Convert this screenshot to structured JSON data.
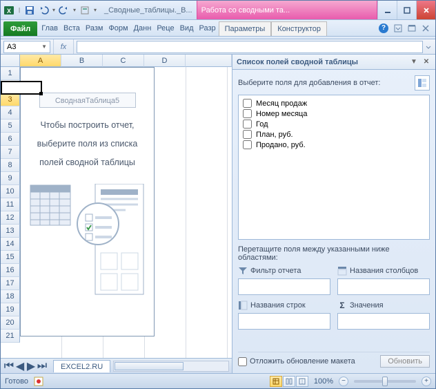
{
  "titlebar": {
    "doc_title": "_Сводные_таблицы._В...",
    "context_title": "Работа со сводными та..."
  },
  "ribbon": {
    "file": "Файл",
    "tabs": [
      "Глав",
      "Вста",
      "Разм",
      "Форм",
      "Данн",
      "Реце",
      "Вид",
      "Разр"
    ],
    "context_tabs": [
      "Параметры",
      "Конструктор"
    ]
  },
  "name_box": "A3",
  "fx_label": "fx",
  "columns": [
    "A",
    "B",
    "C",
    "D"
  ],
  "rows": [
    "1",
    "2",
    "3",
    "4",
    "5",
    "6",
    "7",
    "8",
    "9",
    "10",
    "11",
    "12",
    "13",
    "14",
    "15",
    "16",
    "17",
    "18",
    "19",
    "20",
    "21"
  ],
  "placeholder": {
    "name": "СводнаяТаблица5",
    "hint1": "Чтобы построить отчет,",
    "hint2": "выберите поля из списка",
    "hint3": "полей сводной таблицы"
  },
  "sheet_tab": "EXCEL2.RU",
  "pane": {
    "title": "Список полей сводной таблицы",
    "choose_label": "Выберите поля для добавления в отчет:",
    "fields": [
      "Месяц продаж",
      "Номер месяца",
      "Год",
      "План, руб.",
      "Продано, руб."
    ],
    "drag_label": "Перетащите поля между указанными ниже областями:",
    "area_filter": "Фильтр отчета",
    "area_cols": "Названия столбцов",
    "area_rows": "Названия строк",
    "area_vals": "Значения",
    "defer_label": "Отложить обновление макета",
    "update_btn": "Обновить"
  },
  "status": {
    "ready": "Готово",
    "zoom": "100%"
  },
  "chart_data": null
}
